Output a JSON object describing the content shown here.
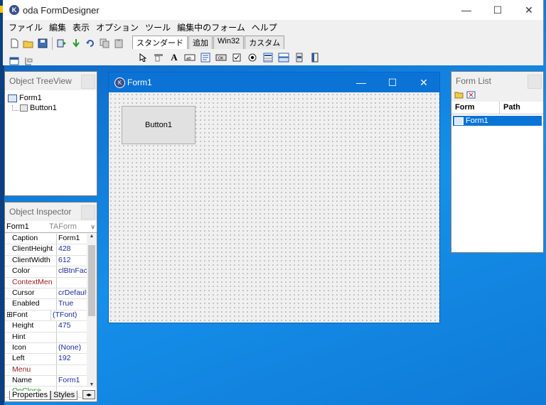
{
  "app": {
    "title": "oda FormDesigner",
    "logo": "K"
  },
  "window_controls": {
    "minimize": "—",
    "maximize": "☐",
    "close": "✕"
  },
  "menu": [
    "ファイル",
    "編集",
    "表示",
    "オプション",
    "ツール",
    "編集中のフォーム",
    "ヘルプ"
  ],
  "palette": {
    "tabs": [
      "スタンダード",
      "追加",
      "Win32",
      "カスタム"
    ],
    "active_tab": 0
  },
  "tree_panel": {
    "title": "Object TreeView",
    "items": [
      "Form1",
      "Button1"
    ]
  },
  "inspector": {
    "title": "Object Inspector",
    "object": "Form1",
    "class": "TAForm",
    "rows": [
      {
        "name": "Caption",
        "value": "Form1",
        "color": "#000000"
      },
      {
        "name": "ClientHeight",
        "value": "428",
        "color": "#000000"
      },
      {
        "name": "ClientWidth",
        "value": "612",
        "color": "#000000"
      },
      {
        "name": "Color",
        "value": "clBtnFace",
        "color": "#000000"
      },
      {
        "name": "ContextMen",
        "value": "",
        "color": "#9b1c1c"
      },
      {
        "name": "Cursor",
        "value": "crDefault",
        "color": "#000000"
      },
      {
        "name": "Enabled",
        "value": "True",
        "color": "#000000"
      },
      {
        "name": "Font",
        "value": "(TFont)",
        "color": "#000000"
      },
      {
        "name": "Height",
        "value": "475",
        "color": "#000000"
      },
      {
        "name": "Hint",
        "value": "",
        "color": "#000000"
      },
      {
        "name": "Icon",
        "value": "(None)",
        "color": "#000000"
      },
      {
        "name": "Left",
        "value": "192",
        "color": "#000000"
      },
      {
        "name": "Menu",
        "value": "",
        "color": "#9b1c1c"
      },
      {
        "name": "Name",
        "value": "Form1",
        "color": "#000000"
      },
      {
        "name": "OnClose",
        "value": "",
        "color": "#1f8a1f"
      }
    ],
    "tabs": [
      "Properties",
      "Styles"
    ]
  },
  "form": {
    "caption": "Form1",
    "button_caption": "Button1"
  },
  "form_list": {
    "title": "Form List",
    "col_form": "Form",
    "col_path": "Path",
    "row_form": "Form1",
    "row_path": ""
  },
  "colors": {
    "accent": "#0b73d6",
    "desktop": "#0a6fd0",
    "event_color": "#1f8a1f",
    "reference_color": "#9b1c1c",
    "value_color": "#1c2b9c"
  }
}
